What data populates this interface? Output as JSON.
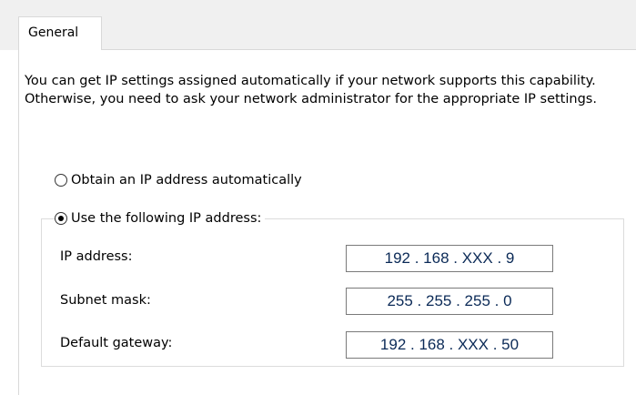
{
  "tabs": [
    {
      "label": "General"
    }
  ],
  "description": "You can get IP settings assigned automatically if your network supports this capability. Otherwise, you need to ask your network administrator for the appropriate IP settings.",
  "radios": [
    {
      "label": "Obtain an IP address automatically",
      "checked": false
    },
    {
      "label": "Use the following IP address:",
      "checked": true
    }
  ],
  "fields": [
    {
      "label": "IP address:",
      "value": "192 . 168 . XXX .  9"
    },
    {
      "label": "Subnet mask:",
      "value": "255 . 255 . 255 .  0"
    },
    {
      "label": "Default gateway:",
      "value": "192 . 168 . XXX .  50"
    }
  ]
}
